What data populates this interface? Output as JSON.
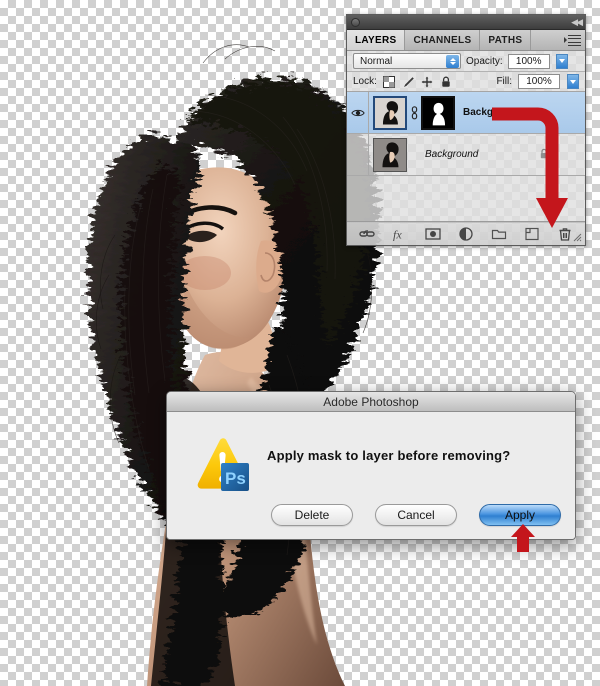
{
  "canvas": {
    "checker_light": "#ffffff",
    "checker_dark": "#d0d0d0",
    "photo_alt": "woman in profile with voluminous dark hair, background masked out"
  },
  "layers_panel": {
    "title_dot": "panel-dot",
    "collapse_label": "◀◀",
    "tabs": [
      {
        "label": "LAYERS",
        "active": true
      },
      {
        "label": "CHANNELS",
        "active": false
      },
      {
        "label": "PATHS",
        "active": false
      }
    ],
    "blend_mode": "Normal",
    "opacity_label": "Opacity:",
    "opacity_value": "100%",
    "lock_label": "Lock:",
    "lock_icons": [
      "lock-transparency-icon",
      "lock-image-icon",
      "lock-position-icon",
      "lock-all-icon"
    ],
    "fill_label": "Fill:",
    "fill_value": "100%",
    "layers": [
      {
        "name": "Background co",
        "visible": true,
        "selected": true,
        "has_mask": true,
        "linked": true,
        "locked": false,
        "italic": false
      },
      {
        "name": "Background",
        "visible": false,
        "selected": false,
        "has_mask": false,
        "linked": false,
        "locked": true,
        "italic": true
      }
    ],
    "bottom_icons": [
      "link-layers-icon",
      "layer-style-fx-icon",
      "add-layer-mask-icon",
      "new-adjustment-layer-icon",
      "new-group-icon",
      "new-layer-icon",
      "delete-layer-trash-icon"
    ]
  },
  "annotations": {
    "arrow_color": "#c4161c",
    "arrow_to_trash": "curved-arrow-to-trash",
    "arrow_to_apply": "up-arrow-to-apply-button"
  },
  "dialog": {
    "title": "Adobe Photoshop",
    "message": "Apply mask to layer before removing?",
    "icon": "warning-triangle-photoshop-icon",
    "app_badge": "Ps",
    "buttons": [
      {
        "label": "Delete",
        "primary": false
      },
      {
        "label": "Cancel",
        "primary": false
      },
      {
        "label": "Apply",
        "primary": true
      }
    ]
  }
}
